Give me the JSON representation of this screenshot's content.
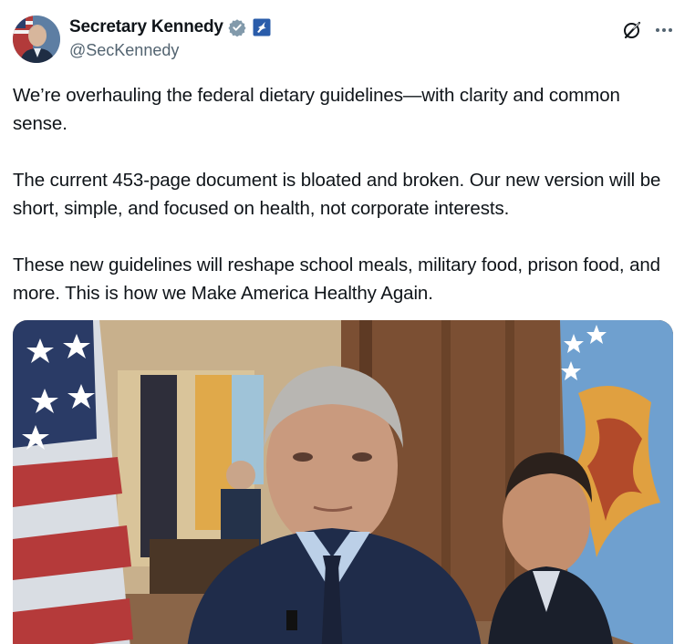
{
  "author": {
    "display_name": "Secretary Kennedy",
    "handle": "@SecKennedy",
    "verified": true,
    "affiliation_badge": "hhs-eagle-icon"
  },
  "actions": {
    "grok_icon": "grok-icon",
    "more_icon": "more-options-icon"
  },
  "tweet": {
    "paragraphs": [
      "We’re overhauling the federal dietary guidelines—with clarity and common sense.",
      "The current 453-page document is bloated and broken. Our new version will be short, simple, and focused on health, not corporate interests.",
      "These new guidelines will reshape school meals, military food, prison food, and more. This is how we Make America Healthy Again."
    ]
  },
  "media": {
    "type": "photo"
  },
  "colors": {
    "verified_blue": "#829aab",
    "text": "#0f1419",
    "secondary_text": "#536471"
  }
}
